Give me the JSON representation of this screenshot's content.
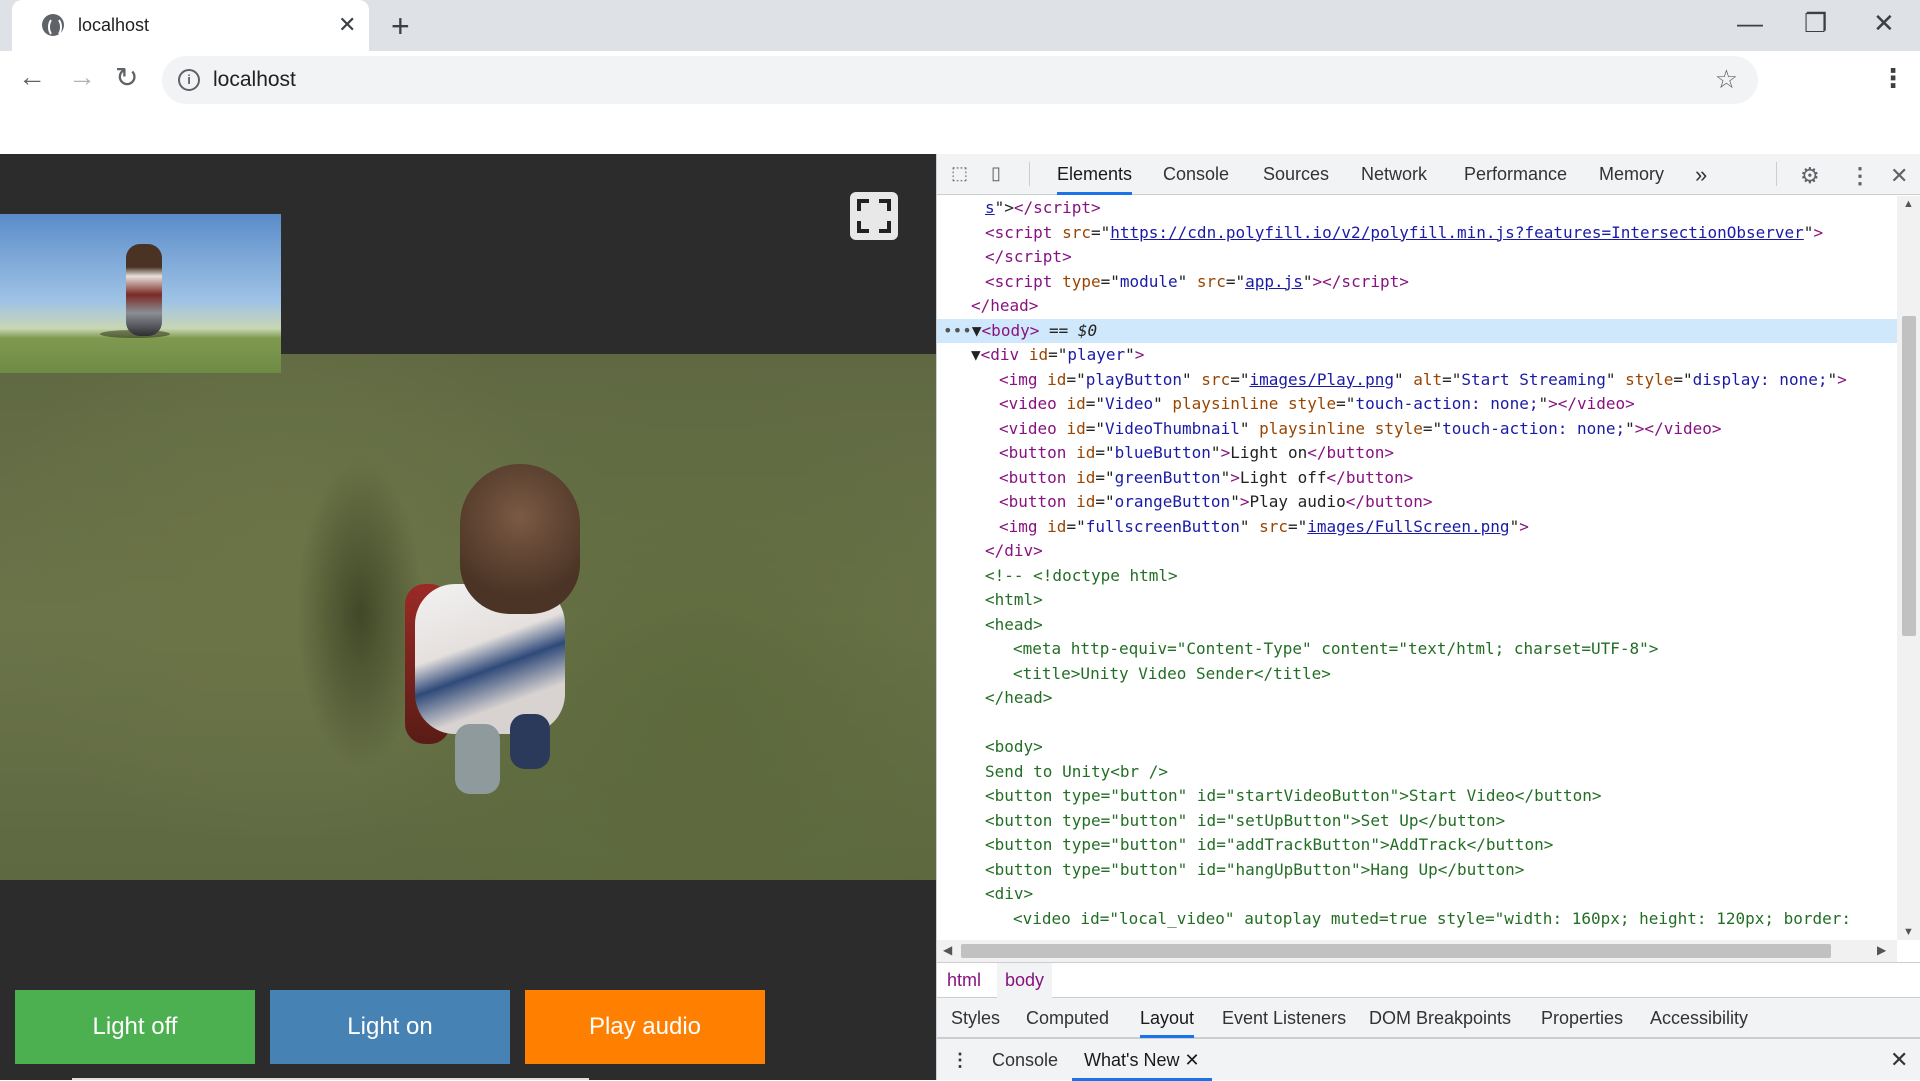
{
  "browser": {
    "tab_title": "localhost",
    "tab_close": "✕",
    "new_tab": "+",
    "url": "localhost",
    "window_controls": {
      "minimize": "—",
      "maximize": "❐",
      "close": "✕"
    }
  },
  "page": {
    "buttons": [
      {
        "label": "Light off",
        "color": "#4caf50"
      },
      {
        "label": "Light on",
        "color": "#4682b4"
      },
      {
        "label": "Play audio",
        "color": "#ff8000"
      }
    ]
  },
  "devtools": {
    "tabs": [
      "Elements",
      "Console",
      "Sources",
      "Network",
      "Performance",
      "Memory"
    ],
    "active_tab": "Elements",
    "more_tabs": "»",
    "code_lines": [
      {
        "indent": 3,
        "html": "<span class='lnk'>s</span><span class='tx'>\"&gt;</span><span class='t'>&lt;/script&gt;</span>"
      },
      {
        "indent": 3,
        "html": "<span class='t'>&lt;script </span><span class='a'>src</span><span class='tx'>=\"</span><span class='lnk'>https://cdn.polyfill.io/v2/polyfill.min.js?features=IntersectionObserver</span><span class='tx'>\"</span><span class='t'>&gt;</span>"
      },
      {
        "indent": 3,
        "html": "<span class='t'>&lt;/script&gt;</span>"
      },
      {
        "indent": 3,
        "html": "<span class='t'>&lt;script </span><span class='a'>type</span><span class='tx'>=\"</span><span class='v'>module</span><span class='tx'>\" </span><span class='a'>src</span><span class='tx'>=\"</span><span class='lnk'>app.js</span><span class='tx'>\"</span><span class='t'>&gt;&lt;/script&gt;</span>"
      },
      {
        "indent": 2,
        "html": "<span class='t'>&lt;/head&gt;</span>"
      },
      {
        "indent": 0,
        "html": "<span class='dots'>•••</span><span class='tx'>▼</span><span class='t'>&lt;body&gt;</span><span class='tx'> == </span><span class='tx' style='font-style:italic'>$0</span>",
        "selected": true
      },
      {
        "indent": 2,
        "html": "<span class='tx'>▼</span><span class='t'>&lt;div </span><span class='a'>id</span><span class='tx'>=\"</span><span class='v'>player</span><span class='tx'>\"</span><span class='t'>&gt;</span>"
      },
      {
        "indent": 4,
        "html": "<span class='t'>&lt;img </span><span class='a'>id</span><span class='tx'>=\"</span><span class='v'>playButton</span><span class='tx'>\" </span><span class='a'>src</span><span class='tx'>=\"</span><span class='lnk'>images/Play.png</span><span class='tx'>\" </span><span class='a'>alt</span><span class='tx'>=\"</span><span class='v'>Start Streaming</span><span class='tx'>\" </span><span class='a'>style</span><span class='tx'>=\"</span><span class='v'>display: none;</span><span class='tx'>\"</span><span class='t'>&gt;</span>"
      },
      {
        "indent": 4,
        "html": "<span class='t'>&lt;video </span><span class='a'>id</span><span class='tx'>=\"</span><span class='v'>Video</span><span class='tx'>\" </span><span class='a'>playsinline style</span><span class='tx'>=\"</span><span class='v'>touch-action: none;</span><span class='tx'>\"</span><span class='t'>&gt;&lt;/video&gt;</span>"
      },
      {
        "indent": 4,
        "html": "<span class='t'>&lt;video </span><span class='a'>id</span><span class='tx'>=\"</span><span class='v'>VideoThumbnail</span><span class='tx'>\" </span><span class='a'>playsinline style</span><span class='tx'>=\"</span><span class='v'>touch-action: none;</span><span class='tx'>\"</span><span class='t'>&gt;&lt;/video&gt;</span>"
      },
      {
        "indent": 4,
        "html": "<span class='t'>&lt;button </span><span class='a'>id</span><span class='tx'>=\"</span><span class='v'>blueButton</span><span class='tx'>\"</span><span class='t'>&gt;</span><span class='tx'>Light on</span><span class='t'>&lt;/button&gt;</span>"
      },
      {
        "indent": 4,
        "html": "<span class='t'>&lt;button </span><span class='a'>id</span><span class='tx'>=\"</span><span class='v'>greenButton</span><span class='tx'>\"</span><span class='t'>&gt;</span><span class='tx'>Light off</span><span class='t'>&lt;/button&gt;</span>"
      },
      {
        "indent": 4,
        "html": "<span class='t'>&lt;button </span><span class='a'>id</span><span class='tx'>=\"</span><span class='v'>orangeButton</span><span class='tx'>\"</span><span class='t'>&gt;</span><span class='tx'>Play audio</span><span class='t'>&lt;/button&gt;</span>"
      },
      {
        "indent": 4,
        "html": "<span class='t'>&lt;img </span><span class='a'>id</span><span class='tx'>=\"</span><span class='v'>fullscreenButton</span><span class='tx'>\" </span><span class='a'>src</span><span class='tx'>=\"</span><span class='lnk'>images/FullScreen.png</span><span class='tx'>\"</span><span class='t'>&gt;</span>"
      },
      {
        "indent": 3,
        "html": "<span class='t'>&lt;/div&gt;</span>"
      },
      {
        "indent": 3,
        "html": "<span class='cm'>&lt;!-- &lt;!doctype html&gt;</span>"
      },
      {
        "indent": 3,
        "html": "<span class='cm'>&lt;html&gt;</span>"
      },
      {
        "indent": 3,
        "html": "<span class='cm'>&lt;head&gt;</span>"
      },
      {
        "indent": 5,
        "html": "<span class='cm'>&lt;meta http-equiv=\"Content-Type\" content=\"text/html; charset=UTF-8\"&gt;</span>"
      },
      {
        "indent": 5,
        "html": "<span class='cm'>&lt;title&gt;Unity Video Sender&lt;/title&gt;</span>"
      },
      {
        "indent": 3,
        "html": "<span class='cm'>&lt;/head&gt;</span>"
      },
      {
        "indent": 3,
        "html": ""
      },
      {
        "indent": 3,
        "html": "<span class='cm'>&lt;body&gt;</span>"
      },
      {
        "indent": 3,
        "html": "<span class='cm'>Send to Unity&lt;br /&gt;</span>"
      },
      {
        "indent": 3,
        "html": "<span class='cm'>&lt;button type=\"button\" id=\"startVideoButton\"&gt;Start Video&lt;/button&gt;</span>"
      },
      {
        "indent": 3,
        "html": "<span class='cm'>&lt;button type=\"button\" id=\"setUpButton\"&gt;Set Up&lt;/button&gt;</span>"
      },
      {
        "indent": 3,
        "html": "<span class='cm'>&lt;button type=\"button\" id=\"addTrackButton\"&gt;AddTrack&lt;/button&gt;</span>"
      },
      {
        "indent": 3,
        "html": "<span class='cm'>&lt;button type=\"button\" id=\"hangUpButton\"&gt;Hang Up&lt;/button&gt;</span>"
      },
      {
        "indent": 3,
        "html": "<span class='cm'>&lt;div&gt;</span>"
      },
      {
        "indent": 5,
        "html": "<span class='cm'>&lt;video id=\"local_video\" autoplay muted=true style=\"width: 160px; height: 120px; border:</span>"
      }
    ],
    "breadcrumbs": [
      "html",
      "body"
    ],
    "subtabs": [
      "Styles",
      "Computed",
      "Layout",
      "Event Listeners",
      "DOM Breakpoints",
      "Properties",
      "Accessibility"
    ],
    "active_subtab": "Layout",
    "drawer_tabs": [
      "Console",
      "What's New"
    ],
    "active_drawer_tab": "What's New"
  }
}
